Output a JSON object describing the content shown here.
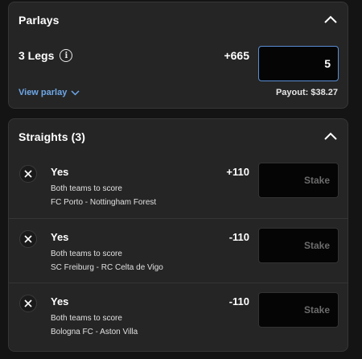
{
  "parlay": {
    "title": "Parlays",
    "legs_label": "3 Legs",
    "odds": "+665",
    "stake_value": "5",
    "view_link": "View parlay",
    "payout": "Payout: $38.27",
    "accent_color": "#6ea8e8"
  },
  "straights": {
    "title": "Straights (3)",
    "stake_placeholder": "Stake",
    "bets": [
      {
        "selection": "Yes",
        "market": "Both teams to score",
        "event": "FC Porto - Nottingham Forest",
        "odds": "+110"
      },
      {
        "selection": "Yes",
        "market": "Both teams to score",
        "event": "SC Freiburg - RC Celta de Vigo",
        "odds": "-110"
      },
      {
        "selection": "Yes",
        "market": "Both teams to score",
        "event": "Bologna FC - Aston Villa",
        "odds": "-110"
      }
    ]
  },
  "icons": {
    "collapse": "chevron-up-icon",
    "info": "info-icon",
    "expand": "chevron-down-icon",
    "remove": "close-icon"
  }
}
